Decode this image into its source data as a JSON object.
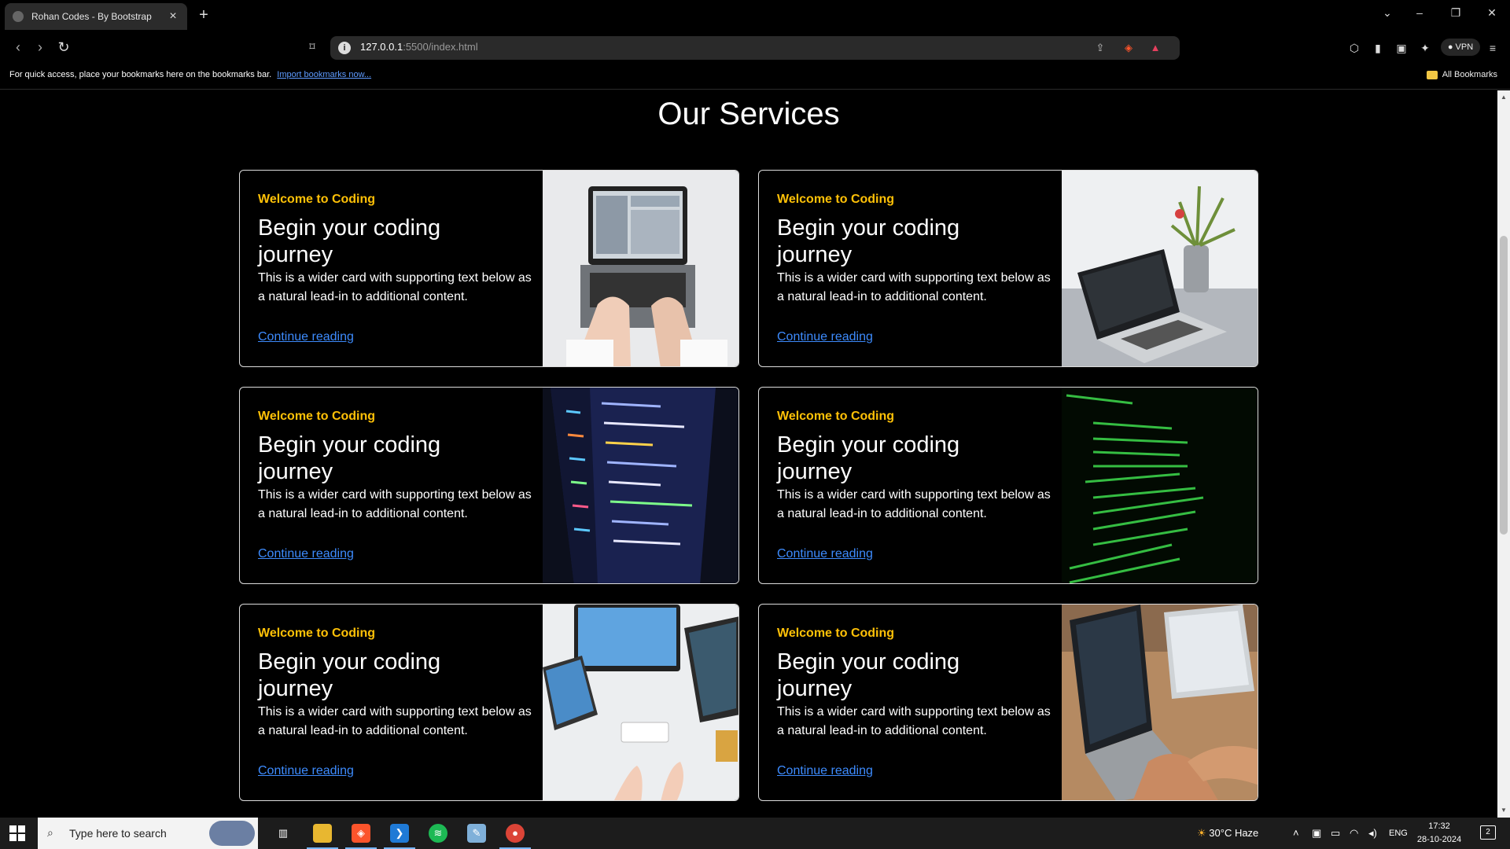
{
  "browser": {
    "tab_title": "Rohan Codes - By Bootstrap",
    "url_host": "127.0.0.1",
    "url_rest": ":5500/index.html",
    "vpn_label": "VPN",
    "bookmarks_bar_text": "For quick access, place your bookmarks here on the bookmarks bar.",
    "bookmarks_bar_link": "Import bookmarks now...",
    "all_bookmarks": "All Bookmarks"
  },
  "page": {
    "section_title": "Our Services",
    "cards": [
      {
        "eyebrow": "Welcome to Coding",
        "title": "Begin your coding journey",
        "text": "This is a wider card with supporting text below as a natural lead-in to additional content.",
        "link": "Continue reading"
      },
      {
        "eyebrow": "Welcome to Coding",
        "title": "Begin your coding journey",
        "text": "This is a wider card with supporting text below as a natural lead-in to additional content.",
        "link": "Continue reading"
      },
      {
        "eyebrow": "Welcome to Coding",
        "title": "Begin your coding journey",
        "text": "This is a wider card with supporting text below as a natural lead-in to additional content.",
        "link": "Continue reading"
      },
      {
        "eyebrow": "Welcome to Coding",
        "title": "Begin your coding journey",
        "text": "This is a wider card with supporting text below as a natural lead-in to additional content.",
        "link": "Continue reading"
      },
      {
        "eyebrow": "Welcome to Coding",
        "title": "Begin your coding journey",
        "text": "This is a wider card with supporting text below as a natural lead-in to additional content.",
        "link": "Continue reading"
      },
      {
        "eyebrow": "Welcome to Coding",
        "title": "Begin your coding journey",
        "text": "This is a wider card with supporting text below as a natural lead-in to additional content.",
        "link": "Continue reading"
      }
    ]
  },
  "taskbar": {
    "search_placeholder": "Type here to search",
    "weather": "30°C  Haze",
    "language": "ENG",
    "time": "17:32",
    "date": "28-10-2024",
    "notification_count": "2"
  },
  "colors": {
    "accent_eyebrow": "#ffc107",
    "link": "#3d8bfd",
    "background": "#000000"
  }
}
